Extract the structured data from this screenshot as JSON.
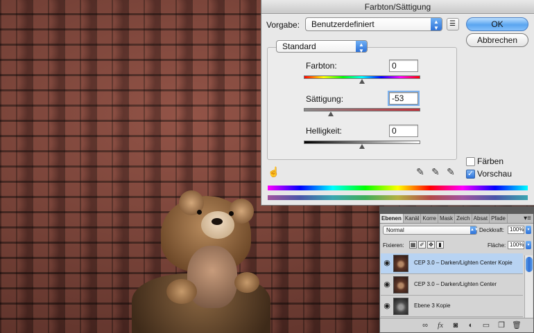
{
  "dialog": {
    "title": "Farbton/Sättigung",
    "preset_label": "Vorgabe:",
    "preset_value": "Benutzerdefiniert",
    "ok": "OK",
    "cancel": "Abbrechen",
    "channel": "Standard",
    "hue_label": "Farbton:",
    "hue_value": "0",
    "saturation_label": "Sättigung:",
    "saturation_value": "-53",
    "lightness_label": "Helligkeit:",
    "lightness_value": "0",
    "colorize_label": "Färben",
    "preview_label": "Vorschau",
    "colorize_checked": false,
    "preview_checked": true
  },
  "layers_panel": {
    "tabs": [
      "Ebenen",
      "Kanäl",
      "Korre",
      "Mask",
      "Zeich",
      "Absat",
      "Pfade"
    ],
    "blend_mode": "Normal",
    "opacity_label": "Deckkraft:",
    "opacity_value": "100%",
    "lock_label": "Fixieren:",
    "fill_label": "Fläche:",
    "fill_value": "100%",
    "layers": [
      {
        "name": "CEP 3.0 – Darken/Lighten Center Kopie",
        "selected": true
      },
      {
        "name": "CEP 3.0 – Darken/Lighten Center",
        "selected": false
      },
      {
        "name": "Ebene 3 Kopie",
        "selected": false
      }
    ]
  }
}
